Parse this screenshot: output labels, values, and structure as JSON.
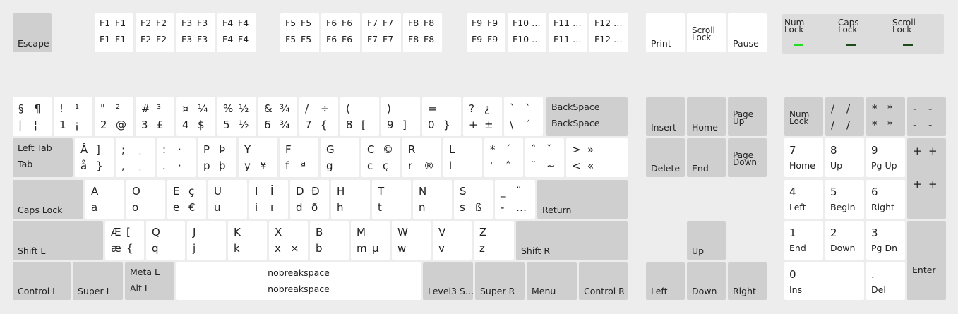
{
  "colors": {
    "background": "#ededed",
    "key_alpha": "#ffffff",
    "key_modifier": "#cfcfcf",
    "lock_panel": "#dcdcdc",
    "led_on": "#22dd22",
    "led_off": "#1b4d1b"
  },
  "indicators": [
    {
      "label": "Num\nLock",
      "led": "on"
    },
    {
      "label": "Caps\nLock",
      "led": "off"
    },
    {
      "label": "Scroll\nLock",
      "led": "off"
    }
  ],
  "keys": [
    {
      "id": "escape",
      "label": "Escape"
    },
    {
      "id": "f1",
      "legends": [
        "F1",
        "F1",
        "F1",
        "F1"
      ]
    },
    {
      "id": "f2",
      "legends": [
        "F2",
        "F2",
        "F2",
        "F2"
      ]
    },
    {
      "id": "f3",
      "legends": [
        "F3",
        "F3",
        "F3",
        "F3"
      ]
    },
    {
      "id": "f4",
      "legends": [
        "F4",
        "F4",
        "F4",
        "F4"
      ]
    },
    {
      "id": "f5",
      "legends": [
        "F5",
        "F5",
        "F5",
        "F5"
      ]
    },
    {
      "id": "f6",
      "legends": [
        "F6",
        "F6",
        "F6",
        "F6"
      ]
    },
    {
      "id": "f7",
      "legends": [
        "F7",
        "F7",
        "F7",
        "F7"
      ]
    },
    {
      "id": "f8",
      "legends": [
        "F8",
        "F8",
        "F8",
        "F8"
      ]
    },
    {
      "id": "f9",
      "legends": [
        "F9",
        "F9",
        "F9",
        "F9"
      ]
    },
    {
      "id": "f10",
      "legends": [
        "F10 …",
        "",
        "F10 …",
        ""
      ]
    },
    {
      "id": "f11",
      "legends": [
        "F11 …",
        "",
        "F11 …",
        ""
      ]
    },
    {
      "id": "f12",
      "legends": [
        "F12 …",
        "",
        "F12 …",
        ""
      ]
    },
    {
      "id": "print",
      "label": "Print"
    },
    {
      "id": "scroll-lock",
      "label": "Scroll\nLock"
    },
    {
      "id": "pause",
      "label": "Pause"
    },
    {
      "id": "section",
      "legends": [
        "§",
        "¶",
        "|",
        "¦"
      ]
    },
    {
      "id": "1",
      "legends": [
        "!",
        "¹",
        "1",
        "¡"
      ]
    },
    {
      "id": "2",
      "legends": [
        "\"",
        "²",
        "2",
        "@"
      ]
    },
    {
      "id": "3",
      "legends": [
        "#",
        "³",
        "3",
        "£"
      ]
    },
    {
      "id": "4",
      "legends": [
        "¤",
        "¼",
        "4",
        "$"
      ]
    },
    {
      "id": "5",
      "legends": [
        "%",
        "½",
        "5",
        "½"
      ]
    },
    {
      "id": "6",
      "legends": [
        "&",
        "¾",
        "6",
        "¾"
      ]
    },
    {
      "id": "7",
      "legends": [
        "/",
        "÷",
        "7",
        "{"
      ]
    },
    {
      "id": "8",
      "legends": [
        "(",
        "",
        "8",
        "["
      ]
    },
    {
      "id": "9",
      "legends": [
        ")",
        "",
        "9",
        "]"
      ]
    },
    {
      "id": "0",
      "legends": [
        "=",
        "",
        "0",
        "}"
      ]
    },
    {
      "id": "question",
      "legends": [
        "?",
        "¿",
        "+",
        "±"
      ]
    },
    {
      "id": "backtick",
      "legends": [
        "`",
        "`",
        "\\",
        "´"
      ]
    },
    {
      "id": "backspace",
      "labels": [
        "BackSpace",
        "BackSpace"
      ]
    },
    {
      "id": "tab",
      "labels": [
        "Left Tab",
        "Tab"
      ]
    },
    {
      "id": "aring",
      "legends": [
        "Å",
        "]",
        "å",
        "}"
      ]
    },
    {
      "id": "semicolon",
      "legends": [
        ";",
        "¸",
        ",",
        "¸"
      ]
    },
    {
      "id": "colon",
      "legends": [
        ":",
        "·",
        ".",
        "·"
      ]
    },
    {
      "id": "p",
      "legends": [
        "P",
        "Þ",
        "p",
        "þ"
      ]
    },
    {
      "id": "y",
      "legends": [
        "Y",
        "",
        "y",
        "¥"
      ]
    },
    {
      "id": "f",
      "legends": [
        "F",
        "",
        "f",
        "ª"
      ]
    },
    {
      "id": "g",
      "legends": [
        "G",
        "",
        "g",
        ""
      ]
    },
    {
      "id": "c",
      "legends": [
        "C",
        "©",
        "c",
        "ç"
      ]
    },
    {
      "id": "r",
      "legends": [
        "R",
        "",
        "r",
        "®"
      ]
    },
    {
      "id": "l",
      "legends": [
        "L",
        "",
        "l",
        ""
      ]
    },
    {
      "id": "asterisk",
      "legends": [
        "*",
        "´",
        "'",
        "˄"
      ]
    },
    {
      "id": "caret",
      "legends": [
        "ˆ",
        "ˇ",
        "¨",
        "~"
      ]
    },
    {
      "id": "greater",
      "legends": [
        ">",
        "»",
        "<",
        "«"
      ]
    },
    {
      "id": "caps-lock",
      "label": "Caps Lock"
    },
    {
      "id": "a",
      "legends": [
        "A",
        "",
        "a",
        ""
      ]
    },
    {
      "id": "o",
      "legends": [
        "O",
        "",
        "o",
        ""
      ]
    },
    {
      "id": "e",
      "legends": [
        "E",
        "ç",
        "e",
        "€"
      ]
    },
    {
      "id": "u",
      "legends": [
        "U",
        "",
        "u",
        ""
      ]
    },
    {
      "id": "i",
      "legends": [
        "I",
        "İ",
        "i",
        "ı"
      ]
    },
    {
      "id": "d",
      "legends": [
        "D",
        "Đ",
        "d",
        "ð"
      ]
    },
    {
      "id": "h",
      "legends": [
        "H",
        "",
        "h",
        ""
      ]
    },
    {
      "id": "t",
      "legends": [
        "T",
        "",
        "t",
        ""
      ]
    },
    {
      "id": "n",
      "legends": [
        "N",
        "",
        "n",
        ""
      ]
    },
    {
      "id": "s",
      "legends": [
        "S",
        "",
        "s",
        "ß"
      ]
    },
    {
      "id": "underscore",
      "legends": [
        "_",
        "¨",
        "-",
        "…"
      ]
    },
    {
      "id": "return",
      "label": "Return"
    },
    {
      "id": "shift-l",
      "label": "Shift L"
    },
    {
      "id": "ae",
      "legends": [
        "Æ",
        "[",
        "æ",
        "{"
      ]
    },
    {
      "id": "q",
      "legends": [
        "Q",
        "",
        "q",
        ""
      ]
    },
    {
      "id": "j",
      "legends": [
        "J",
        "",
        "j",
        ""
      ]
    },
    {
      "id": "k",
      "legends": [
        "K",
        "",
        "k",
        ""
      ]
    },
    {
      "id": "x",
      "legends": [
        "X",
        "",
        "x",
        "×"
      ]
    },
    {
      "id": "b",
      "legends": [
        "B",
        "",
        "b",
        ""
      ]
    },
    {
      "id": "m",
      "legends": [
        "M",
        "",
        "m",
        "µ"
      ]
    },
    {
      "id": "w",
      "legends": [
        "W",
        "",
        "w",
        ""
      ]
    },
    {
      "id": "v",
      "legends": [
        "V",
        "",
        "v",
        ""
      ]
    },
    {
      "id": "z",
      "legends": [
        "Z",
        "",
        "z",
        ""
      ]
    },
    {
      "id": "shift-r",
      "label": "Shift R"
    },
    {
      "id": "control-l",
      "label": "Control L"
    },
    {
      "id": "super-l",
      "label": "Super L"
    },
    {
      "id": "alt",
      "labels": [
        "Meta L",
        "Alt L"
      ]
    },
    {
      "id": "space",
      "labels": [
        "nobreakspace",
        "nobreakspace"
      ]
    },
    {
      "id": "level3",
      "label": "Level3 S…"
    },
    {
      "id": "super-r",
      "label": "Super R"
    },
    {
      "id": "menu",
      "label": "Menu"
    },
    {
      "id": "control-r",
      "label": "Control R"
    },
    {
      "id": "insert",
      "label": "Insert"
    },
    {
      "id": "home",
      "label": "Home"
    },
    {
      "id": "page-up",
      "label": "Page\nUp"
    },
    {
      "id": "delete",
      "label": "Delete"
    },
    {
      "id": "end",
      "label": "End"
    },
    {
      "id": "page-down",
      "label": "Page\nDown"
    },
    {
      "id": "up",
      "label": "Up"
    },
    {
      "id": "left",
      "label": "Left"
    },
    {
      "id": "down",
      "label": "Down"
    },
    {
      "id": "right",
      "label": "Right"
    },
    {
      "id": "num-lock",
      "label": "Num\nLock"
    },
    {
      "id": "kp-divide",
      "legends": [
        "/",
        "/",
        "/",
        "/"
      ]
    },
    {
      "id": "kp-multiply",
      "legends": [
        "*",
        "*",
        "*",
        "*"
      ]
    },
    {
      "id": "kp-subtract",
      "legends": [
        "-",
        "-",
        "-",
        "-"
      ]
    },
    {
      "id": "kp-7",
      "labels": [
        "7",
        "Home"
      ]
    },
    {
      "id": "kp-8",
      "labels": [
        "8",
        "Up"
      ]
    },
    {
      "id": "kp-9",
      "labels": [
        "9",
        "Pg Up"
      ]
    },
    {
      "id": "kp-add",
      "legends": [
        "+",
        "+",
        "+",
        "+"
      ]
    },
    {
      "id": "kp-4",
      "labels": [
        "4",
        "Left"
      ]
    },
    {
      "id": "kp-5",
      "labels": [
        "5",
        "Begin"
      ]
    },
    {
      "id": "kp-6",
      "labels": [
        "6",
        "Right"
      ]
    },
    {
      "id": "kp-1",
      "labels": [
        "1",
        "End"
      ]
    },
    {
      "id": "kp-2",
      "labels": [
        "2",
        "Down"
      ]
    },
    {
      "id": "kp-3",
      "labels": [
        "3",
        "Pg Dn"
      ]
    },
    {
      "id": "kp-enter",
      "label": "Enter"
    },
    {
      "id": "kp-0",
      "labels": [
        "0",
        "Ins"
      ]
    },
    {
      "id": "kp-decimal",
      "labels": [
        ".",
        "Del"
      ]
    }
  ]
}
